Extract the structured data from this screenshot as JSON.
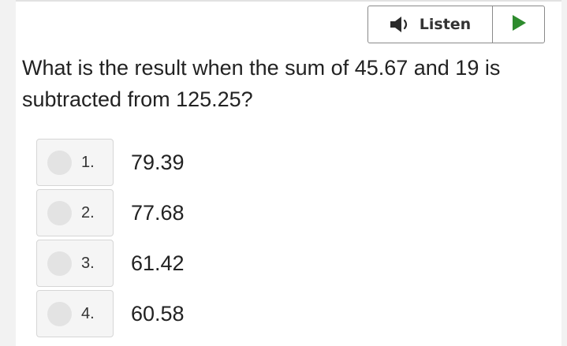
{
  "listen": {
    "label": "Listen",
    "speaker_icon": "speaker-icon",
    "play_icon": "play-icon",
    "play_color": "#2e8b2e"
  },
  "question": {
    "text": "What is the result when the sum of 45.67 and 19 is subtracted from 125.25?"
  },
  "choices": [
    {
      "number": "1.",
      "value": "79.39"
    },
    {
      "number": "2.",
      "value": "77.68"
    },
    {
      "number": "3.",
      "value": "61.42"
    },
    {
      "number": "4.",
      "value": "60.58"
    }
  ]
}
